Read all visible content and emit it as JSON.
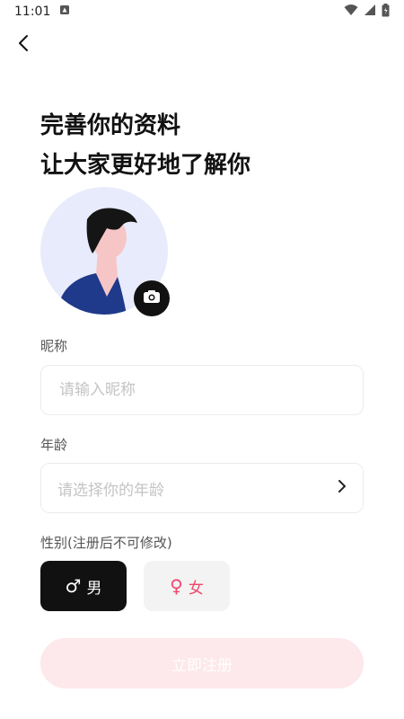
{
  "status_bar": {
    "time": "11:01"
  },
  "title": {
    "line1": "完善你的资料",
    "line2": "让大家更好地了解你"
  },
  "nickname": {
    "label": "昵称",
    "placeholder": "请输入昵称",
    "value": ""
  },
  "age": {
    "label": "年龄",
    "placeholder": "请选择你的年龄"
  },
  "gender": {
    "label": "性别(注册后不可修改)",
    "male_symbol": "♂",
    "male_label": "男",
    "female_symbol": "♀",
    "female_label": "女",
    "selected": "male"
  },
  "register": {
    "label": "立即注册"
  },
  "colors": {
    "accent_female": "#F0466E",
    "register_bg": "#FDE8EB",
    "selected_bg": "#111111",
    "avatar_bg": "#E8EBFB"
  },
  "icons": {
    "back": "chevron-left-icon",
    "camera": "camera-icon",
    "age_arrow": "chevron-right-icon"
  }
}
